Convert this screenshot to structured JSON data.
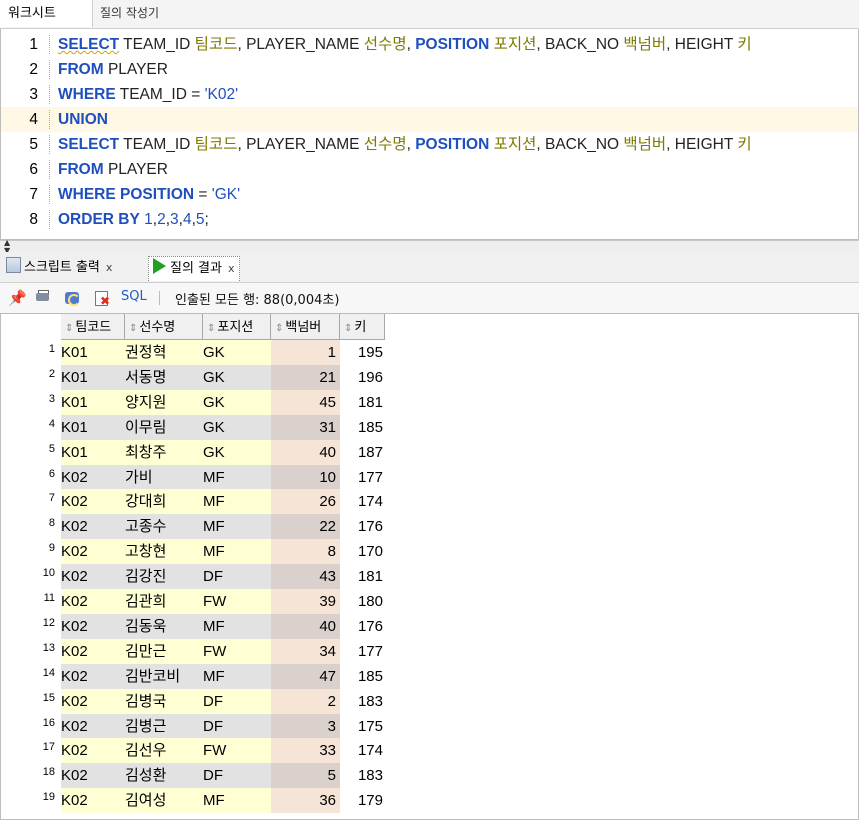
{
  "tabs": {
    "worksheet": "워크시트",
    "query_builder": "질의 작성기"
  },
  "editor": {
    "lines": [
      {
        "num": "1",
        "tokens": [
          {
            "t": "SELECT",
            "c": "kw",
            "wavy": true
          },
          {
            "t": " TEAM_ID ",
            "c": "id"
          },
          {
            "t": "팀코드",
            "c": "al"
          },
          {
            "t": ", PLAYER_NAME ",
            "c": "id"
          },
          {
            "t": "선수명",
            "c": "al"
          },
          {
            "t": ", ",
            "c": "sym"
          },
          {
            "t": "POSITION",
            "c": "kw"
          },
          {
            "t": " ",
            "c": "sym"
          },
          {
            "t": "포지션",
            "c": "al"
          },
          {
            "t": ", BACK_NO ",
            "c": "id"
          },
          {
            "t": "백넘버",
            "c": "al"
          },
          {
            "t": ", HEIGHT ",
            "c": "id"
          },
          {
            "t": "키",
            "c": "al"
          }
        ]
      },
      {
        "num": "2",
        "tokens": [
          {
            "t": "FROM",
            "c": "kw"
          },
          {
            "t": " PLAYER",
            "c": "id"
          }
        ]
      },
      {
        "num": "3",
        "tokens": [
          {
            "t": "WHERE",
            "c": "kw"
          },
          {
            "t": " TEAM_ID = ",
            "c": "id"
          },
          {
            "t": "'K02'",
            "c": "str"
          }
        ]
      },
      {
        "num": "4",
        "highlight": true,
        "tokens": [
          {
            "t": "UNION",
            "c": "kw"
          }
        ]
      },
      {
        "num": "5",
        "tokens": [
          {
            "t": "SELECT",
            "c": "kw"
          },
          {
            "t": " TEAM_ID ",
            "c": "id"
          },
          {
            "t": "팀코드",
            "c": "al"
          },
          {
            "t": ", PLAYER_NAME ",
            "c": "id"
          },
          {
            "t": "선수명",
            "c": "al"
          },
          {
            "t": ", ",
            "c": "sym"
          },
          {
            "t": "POSITION",
            "c": "kw"
          },
          {
            "t": " ",
            "c": "sym"
          },
          {
            "t": "포지션",
            "c": "al"
          },
          {
            "t": ", BACK_NO ",
            "c": "id"
          },
          {
            "t": "백넘버",
            "c": "al"
          },
          {
            "t": ", HEIGHT ",
            "c": "id"
          },
          {
            "t": "키",
            "c": "al"
          }
        ]
      },
      {
        "num": "6",
        "tokens": [
          {
            "t": "FROM",
            "c": "kw"
          },
          {
            "t": " PLAYER",
            "c": "id"
          }
        ]
      },
      {
        "num": "7",
        "tokens": [
          {
            "t": "WHERE",
            "c": "kw"
          },
          {
            "t": " ",
            "c": "sym"
          },
          {
            "t": "POSITION",
            "c": "kw"
          },
          {
            "t": " = ",
            "c": "id"
          },
          {
            "t": "'GK'",
            "c": "str"
          }
        ]
      },
      {
        "num": "8",
        "tokens": [
          {
            "t": "ORDER BY",
            "c": "kw"
          },
          {
            "t": " ",
            "c": "sym"
          },
          {
            "t": "1",
            "c": "num-lit"
          },
          {
            "t": ",",
            "c": "sym"
          },
          {
            "t": "2",
            "c": "num-lit"
          },
          {
            "t": ",",
            "c": "sym"
          },
          {
            "t": "3",
            "c": "num-lit"
          },
          {
            "t": ",",
            "c": "sym"
          },
          {
            "t": "4",
            "c": "num-lit"
          },
          {
            "t": ",",
            "c": "sym"
          },
          {
            "t": "5",
            "c": "num-lit"
          },
          {
            "t": ";",
            "c": "sym"
          }
        ]
      }
    ]
  },
  "results": {
    "tabs": [
      {
        "label": "스크립트 출력",
        "close": "x"
      },
      {
        "label": "질의 결과",
        "close": "x"
      }
    ],
    "toolbar": {
      "sql_label": "SQL",
      "status": "인출된 모든 행: 88(0,004초)"
    },
    "columns": [
      "팀코드",
      "선수명",
      "포지션",
      "백넘버",
      "키"
    ],
    "rows": [
      {
        "n": "1",
        "cells": [
          "K01",
          "권정혁",
          "GK",
          "1",
          "195"
        ]
      },
      {
        "n": "2",
        "cells": [
          "K01",
          "서동명",
          "GK",
          "21",
          "196"
        ]
      },
      {
        "n": "3",
        "cells": [
          "K01",
          "양지원",
          "GK",
          "45",
          "181"
        ]
      },
      {
        "n": "4",
        "cells": [
          "K01",
          "이무림",
          "GK",
          "31",
          "185"
        ]
      },
      {
        "n": "5",
        "cells": [
          "K01",
          "최창주",
          "GK",
          "40",
          "187"
        ]
      },
      {
        "n": "6",
        "cells": [
          "K02",
          "가비",
          "MF",
          "10",
          "177"
        ]
      },
      {
        "n": "7",
        "cells": [
          "K02",
          "강대희",
          "MF",
          "26",
          "174"
        ]
      },
      {
        "n": "8",
        "cells": [
          "K02",
          "고종수",
          "MF",
          "22",
          "176"
        ]
      },
      {
        "n": "9",
        "cells": [
          "K02",
          "고창현",
          "MF",
          "8",
          "170"
        ]
      },
      {
        "n": "10",
        "cells": [
          "K02",
          "김강진",
          "DF",
          "43",
          "181"
        ]
      },
      {
        "n": "11",
        "cells": [
          "K02",
          "김관희",
          "FW",
          "39",
          "180"
        ]
      },
      {
        "n": "12",
        "cells": [
          "K02",
          "김동욱",
          "MF",
          "40",
          "176"
        ]
      },
      {
        "n": "13",
        "cells": [
          "K02",
          "김만근",
          "FW",
          "34",
          "177"
        ]
      },
      {
        "n": "14",
        "cells": [
          "K02",
          "김반코비",
          "MF",
          "47",
          "185"
        ]
      },
      {
        "n": "15",
        "cells": [
          "K02",
          "김병국",
          "DF",
          "2",
          "183"
        ]
      },
      {
        "n": "16",
        "cells": [
          "K02",
          "김병근",
          "DF",
          "3",
          "175"
        ]
      },
      {
        "n": "17",
        "cells": [
          "K02",
          "김선우",
          "FW",
          "33",
          "174"
        ]
      },
      {
        "n": "18",
        "cells": [
          "K02",
          "김성환",
          "DF",
          "5",
          "183"
        ]
      },
      {
        "n": "19",
        "cells": [
          "K02",
          "김여성",
          "MF",
          "36",
          "179"
        ]
      }
    ]
  },
  "colors": {
    "row_odd": "#ffffd4",
    "row_even": "#e2e2e2",
    "num_odd": "#f6e5d6",
    "num_even": "#dad1cc"
  }
}
